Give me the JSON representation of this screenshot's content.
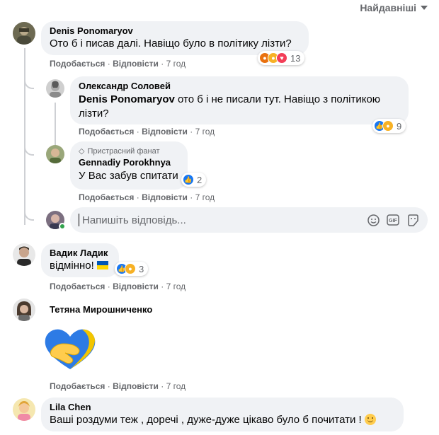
{
  "sort_label": "Найдавніші",
  "labels": {
    "like": "Подобається",
    "reply": "Відповісти",
    "sep": "·"
  },
  "comments": [
    {
      "author": "Denis Ponomaryov",
      "text": "Ото б і писав далі. Навіщо було в політику лізти?",
      "time": "7 год",
      "reactions": "13"
    },
    {
      "author": "Олександр Соловей",
      "mention": "Denis Ponomaryov",
      "text_line1": " ото б і не писали тут. Навіщо з політикою",
      "text_line2": "лізти?",
      "time": "7 год",
      "reactions": "9"
    },
    {
      "badge": "Пристрасний фанат",
      "author": "Gennadiy Porokhnya",
      "text": "У Вас забув спитати",
      "time": "7 год",
      "reactions": "2"
    },
    {
      "author": "Вадик Ладик",
      "text": "відмінно!",
      "time": "7 год",
      "reactions": "3"
    },
    {
      "author": "Тетяна Мирошниченко",
      "time": "7 год"
    },
    {
      "author": "Lila Chen",
      "text": "Ваші роздуми теж , доречі , дуже-дуже цікаво було б почитати !"
    }
  ],
  "reply_input": {
    "placeholder": "Напишіть відповідь..."
  },
  "colors": {
    "like": "#1877f2",
    "meta": "#65676b",
    "bubble": "#f0f2f5"
  }
}
